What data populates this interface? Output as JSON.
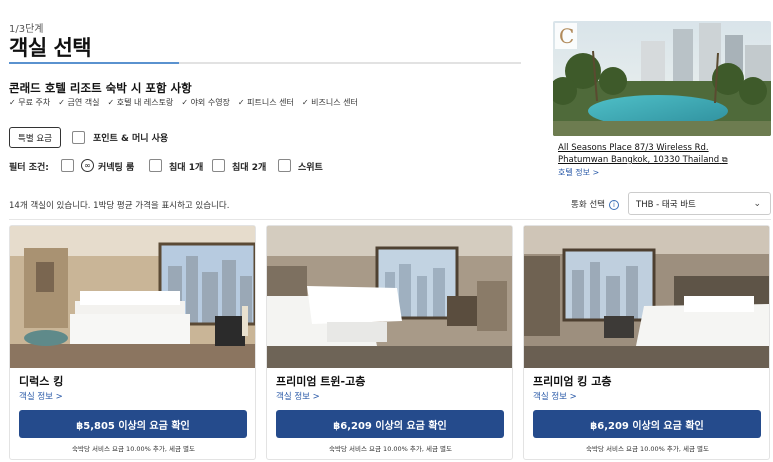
{
  "header": {
    "step": "1/3단계",
    "title": "객실 선택"
  },
  "inclusions": {
    "title": "콘래드 호텔 리조트 숙박 시 포함 사항",
    "items": [
      "✓ 무료 주차",
      "✓ 금연 객실",
      "✓ 호텔 내 레스토랑",
      "✓ 야외 수영장",
      "✓ 피트니스 센터",
      "✓ 비즈니스 센터"
    ]
  },
  "rates": {
    "special_label": "특별 요금",
    "points_label": "포인트 & 머니 사용"
  },
  "filters": {
    "label": "필터 조건:",
    "options": [
      "커넥팅 룸",
      "침대 1개",
      "침대 2개",
      "스위트"
    ]
  },
  "results": {
    "count_text": "14개 객실이 있습니다. 1박당 평균 가격을 표시하고 있습니다.",
    "currency_label": "통화 선택",
    "currency_value": "THB - 태국 바트"
  },
  "hotel": {
    "logo_letter": "C",
    "address_line1": "All Seasons Place 87/3 Wireless Rd.",
    "address_line2": "Phatumwan Bangkok, 10330 Thailand",
    "info_link": "호텔 정보 >"
  },
  "rooms": [
    {
      "name": "디럭스 킹",
      "info": "객실 정보 >",
      "button": "฿5,805 이상의 요금 확인",
      "note": "숙박당 서비스 요금 10.00% 추가, 세금 별도"
    },
    {
      "name": "프리미엄 트윈-고층",
      "info": "객실 정보 >",
      "button": "฿6,209 이상의 요금 확인",
      "note": "숙박당 서비스 요금 10.00% 추가, 세금 별도"
    },
    {
      "name": "프리미엄 킹 고층",
      "info": "객실 정보 >",
      "button": "฿6,209 이상의 요금 확인",
      "note": "숙박당 서비스 요금 10.00% 추가, 세금 별도"
    }
  ],
  "colors": {
    "primary_button": "#254b8c",
    "link": "#2a5aa8",
    "progress": "#5a92cf"
  }
}
